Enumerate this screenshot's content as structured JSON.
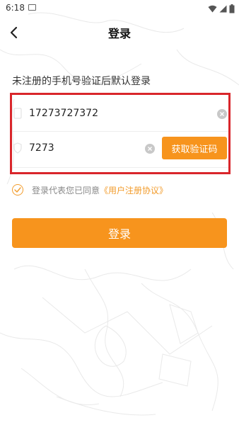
{
  "status_bar": {
    "time": "6:18"
  },
  "nav": {
    "title": "登录",
    "back_icon": "chevron-left-icon"
  },
  "hint": "未注册的手机号验证后默认登录",
  "form": {
    "phone_value": "17273727372",
    "code_value": "7273",
    "get_code_label": "获取验证码"
  },
  "agreement": {
    "text": "登录代表您已同意",
    "link": "《用户注册协议》"
  },
  "login_button": "登录",
  "colors": {
    "accent": "#f7941d",
    "highlight_frame": "#d9262b",
    "link": "#f29c2c"
  }
}
